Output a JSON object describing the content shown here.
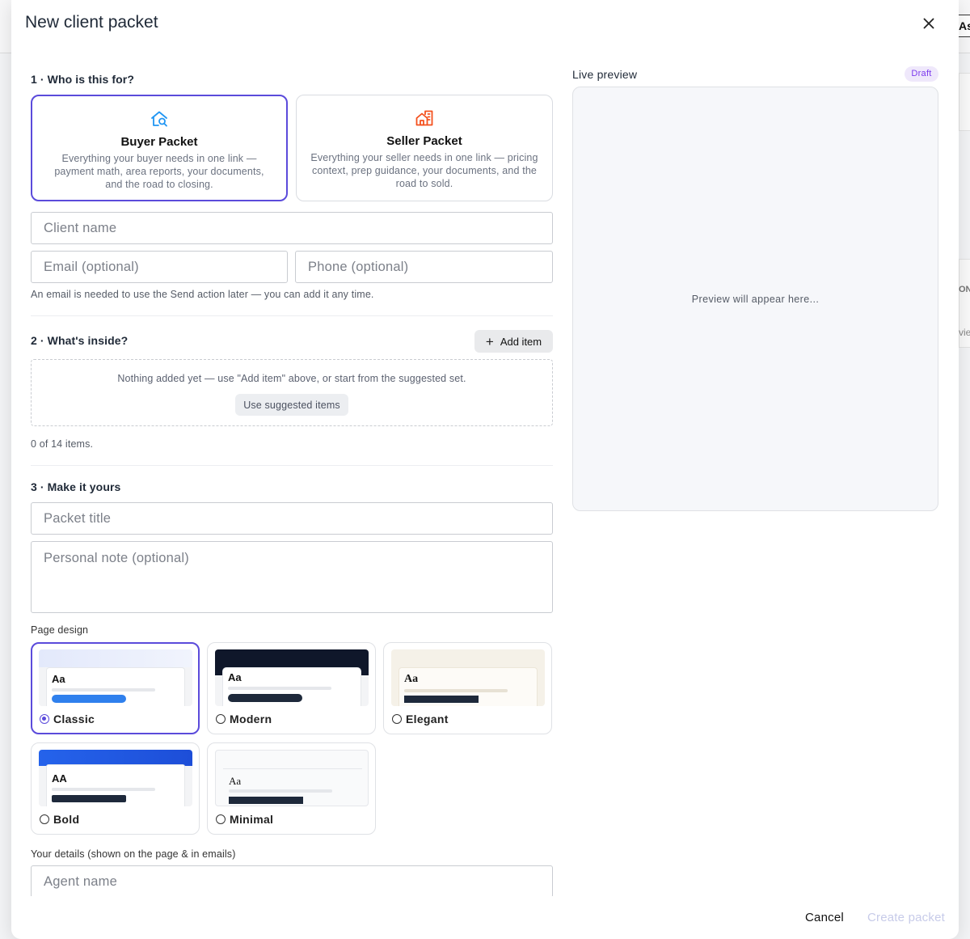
{
  "modal": {
    "title": "New client packet"
  },
  "background": {
    "tab_label": "As",
    "fragment_1": "ONY",
    "fragment_2": "vie"
  },
  "section1": {
    "heading": "1 · Who is this for?",
    "buyer": {
      "title": "Buyer Packet",
      "description": "Everything your buyer needs in one link — payment math, area reports, your documents, and the road to closing.",
      "icon": "house-search-icon",
      "color": "#2196f3"
    },
    "seller": {
      "title": "Seller Packet",
      "description": "Everything your seller needs in one link — pricing context, prep guidance, your documents, and the road to sold.",
      "icon": "house-city-icon",
      "color": "#f4511e"
    },
    "client_name_placeholder": "Client name",
    "email_placeholder": "Email (optional)",
    "phone_placeholder": "Phone (optional)",
    "helper": "An email is needed to use the Send action later — you can add it any time."
  },
  "section2": {
    "heading": "2 · What's inside?",
    "add_item_label": "Add item",
    "empty_text": "Nothing added yet — use \"Add item\" above, or start from the suggested set.",
    "suggested_label": "Use suggested items",
    "count": "0 of 14 items."
  },
  "section3": {
    "heading": "3 · Make it yours",
    "title_placeholder": "Packet title",
    "note_placeholder": "Personal note (optional)",
    "design_label": "Page design",
    "designs": [
      {
        "label": "Classic",
        "sample": "Aa",
        "selected": true
      },
      {
        "label": "Modern",
        "sample": "Aa",
        "selected": false
      },
      {
        "label": "Elegant",
        "sample": "Aa",
        "selected": false
      },
      {
        "label": "Bold",
        "sample": "AA",
        "selected": false
      },
      {
        "label": "Minimal",
        "sample": "Aa",
        "selected": false
      }
    ],
    "details_label": "Your details (shown on the page & in emails)",
    "agent_name_placeholder": "Agent name"
  },
  "preview": {
    "label": "Live preview",
    "badge": "Draft",
    "placeholder": "Preview will appear here..."
  },
  "footer": {
    "cancel_label": "Cancel",
    "create_label": "Create packet"
  },
  "colors": {
    "accent": "#5b4bdb",
    "draft_badge_bg": "#efe8fb",
    "draft_badge_text": "#7c3aed",
    "disabled_text": "#c7cbe9"
  }
}
